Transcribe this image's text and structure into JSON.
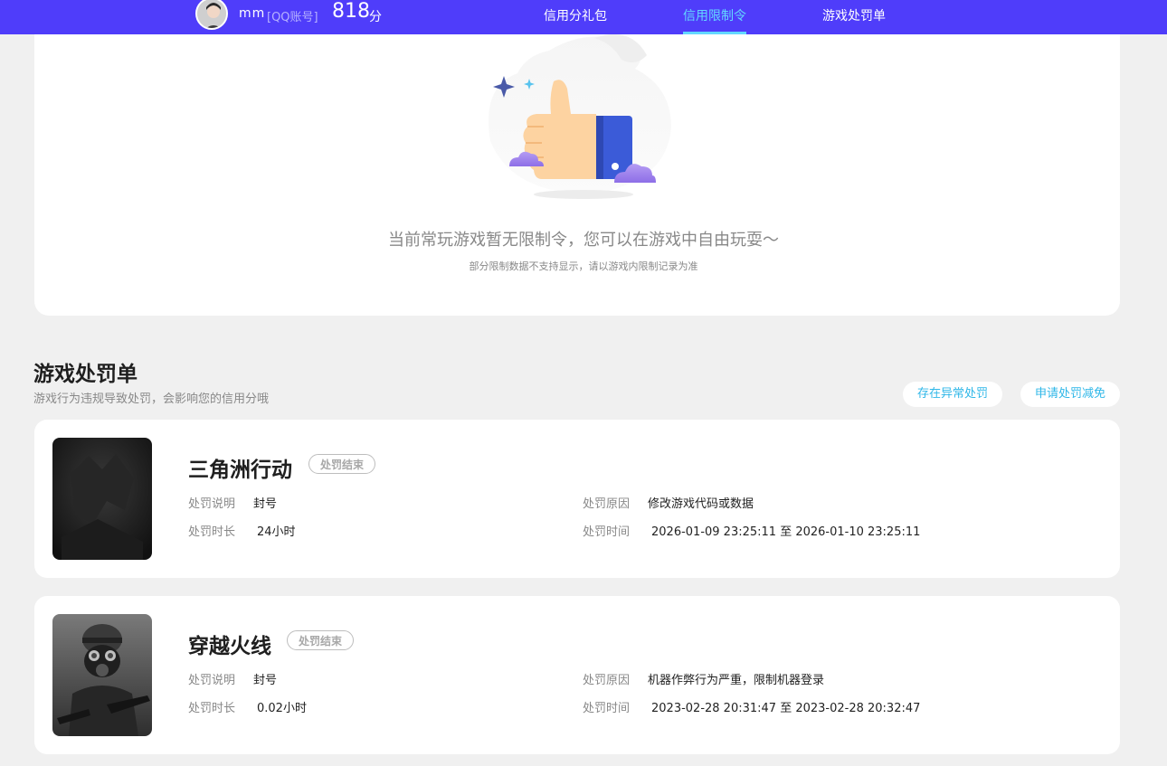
{
  "user": {
    "name": "mm",
    "account_type": "[QQ账号]",
    "score": "818",
    "score_unit": "分"
  },
  "nav": {
    "items": [
      {
        "label": "信用分礼包",
        "active": false
      },
      {
        "label": "信用限制令",
        "active": true
      },
      {
        "label": "游戏处罚单",
        "active": false
      }
    ]
  },
  "empty_state": {
    "message": "当前常玩游戏暂无限制令，您可以在游戏中自由玩耍～",
    "note": "部分限制数据不支持显示，请以游戏内限制记录为准"
  },
  "penalty_section": {
    "title": "游戏处罚单",
    "subtitle": "游戏行为违规导致处罚，会影响您的信用分哦",
    "btn_abnormal": "存在异常处罚",
    "btn_appeal": "申请处罚减免"
  },
  "penalties": [
    {
      "game": "三角洲行动",
      "status": "处罚结束",
      "desc_label": "处罚说明",
      "desc": "封号",
      "dur_label": "处罚时长",
      "duration": "24小时",
      "reason_label": "处罚原因",
      "reason": "修改游戏代码或数据",
      "time_label": "处罚时间",
      "time": "2026-01-09 23:25:11 至 2026-01-10 23:25:11"
    },
    {
      "game": "穿越火线",
      "status": "处罚结束",
      "desc_label": "处罚说明",
      "desc": "封号",
      "dur_label": "处罚时长",
      "duration": "0.02小时",
      "reason_label": "处罚原因",
      "reason": "机器作弊行为严重，限制机器登录",
      "time_label": "处罚时间",
      "time": "2023-02-28 20:31:47 至 2023-02-28 20:32:47"
    }
  ],
  "colors": {
    "topbar": "#4f3dfa",
    "accent": "#63d8ff",
    "link": "#2fb7e8",
    "page_bg": "#f0f0f0"
  }
}
